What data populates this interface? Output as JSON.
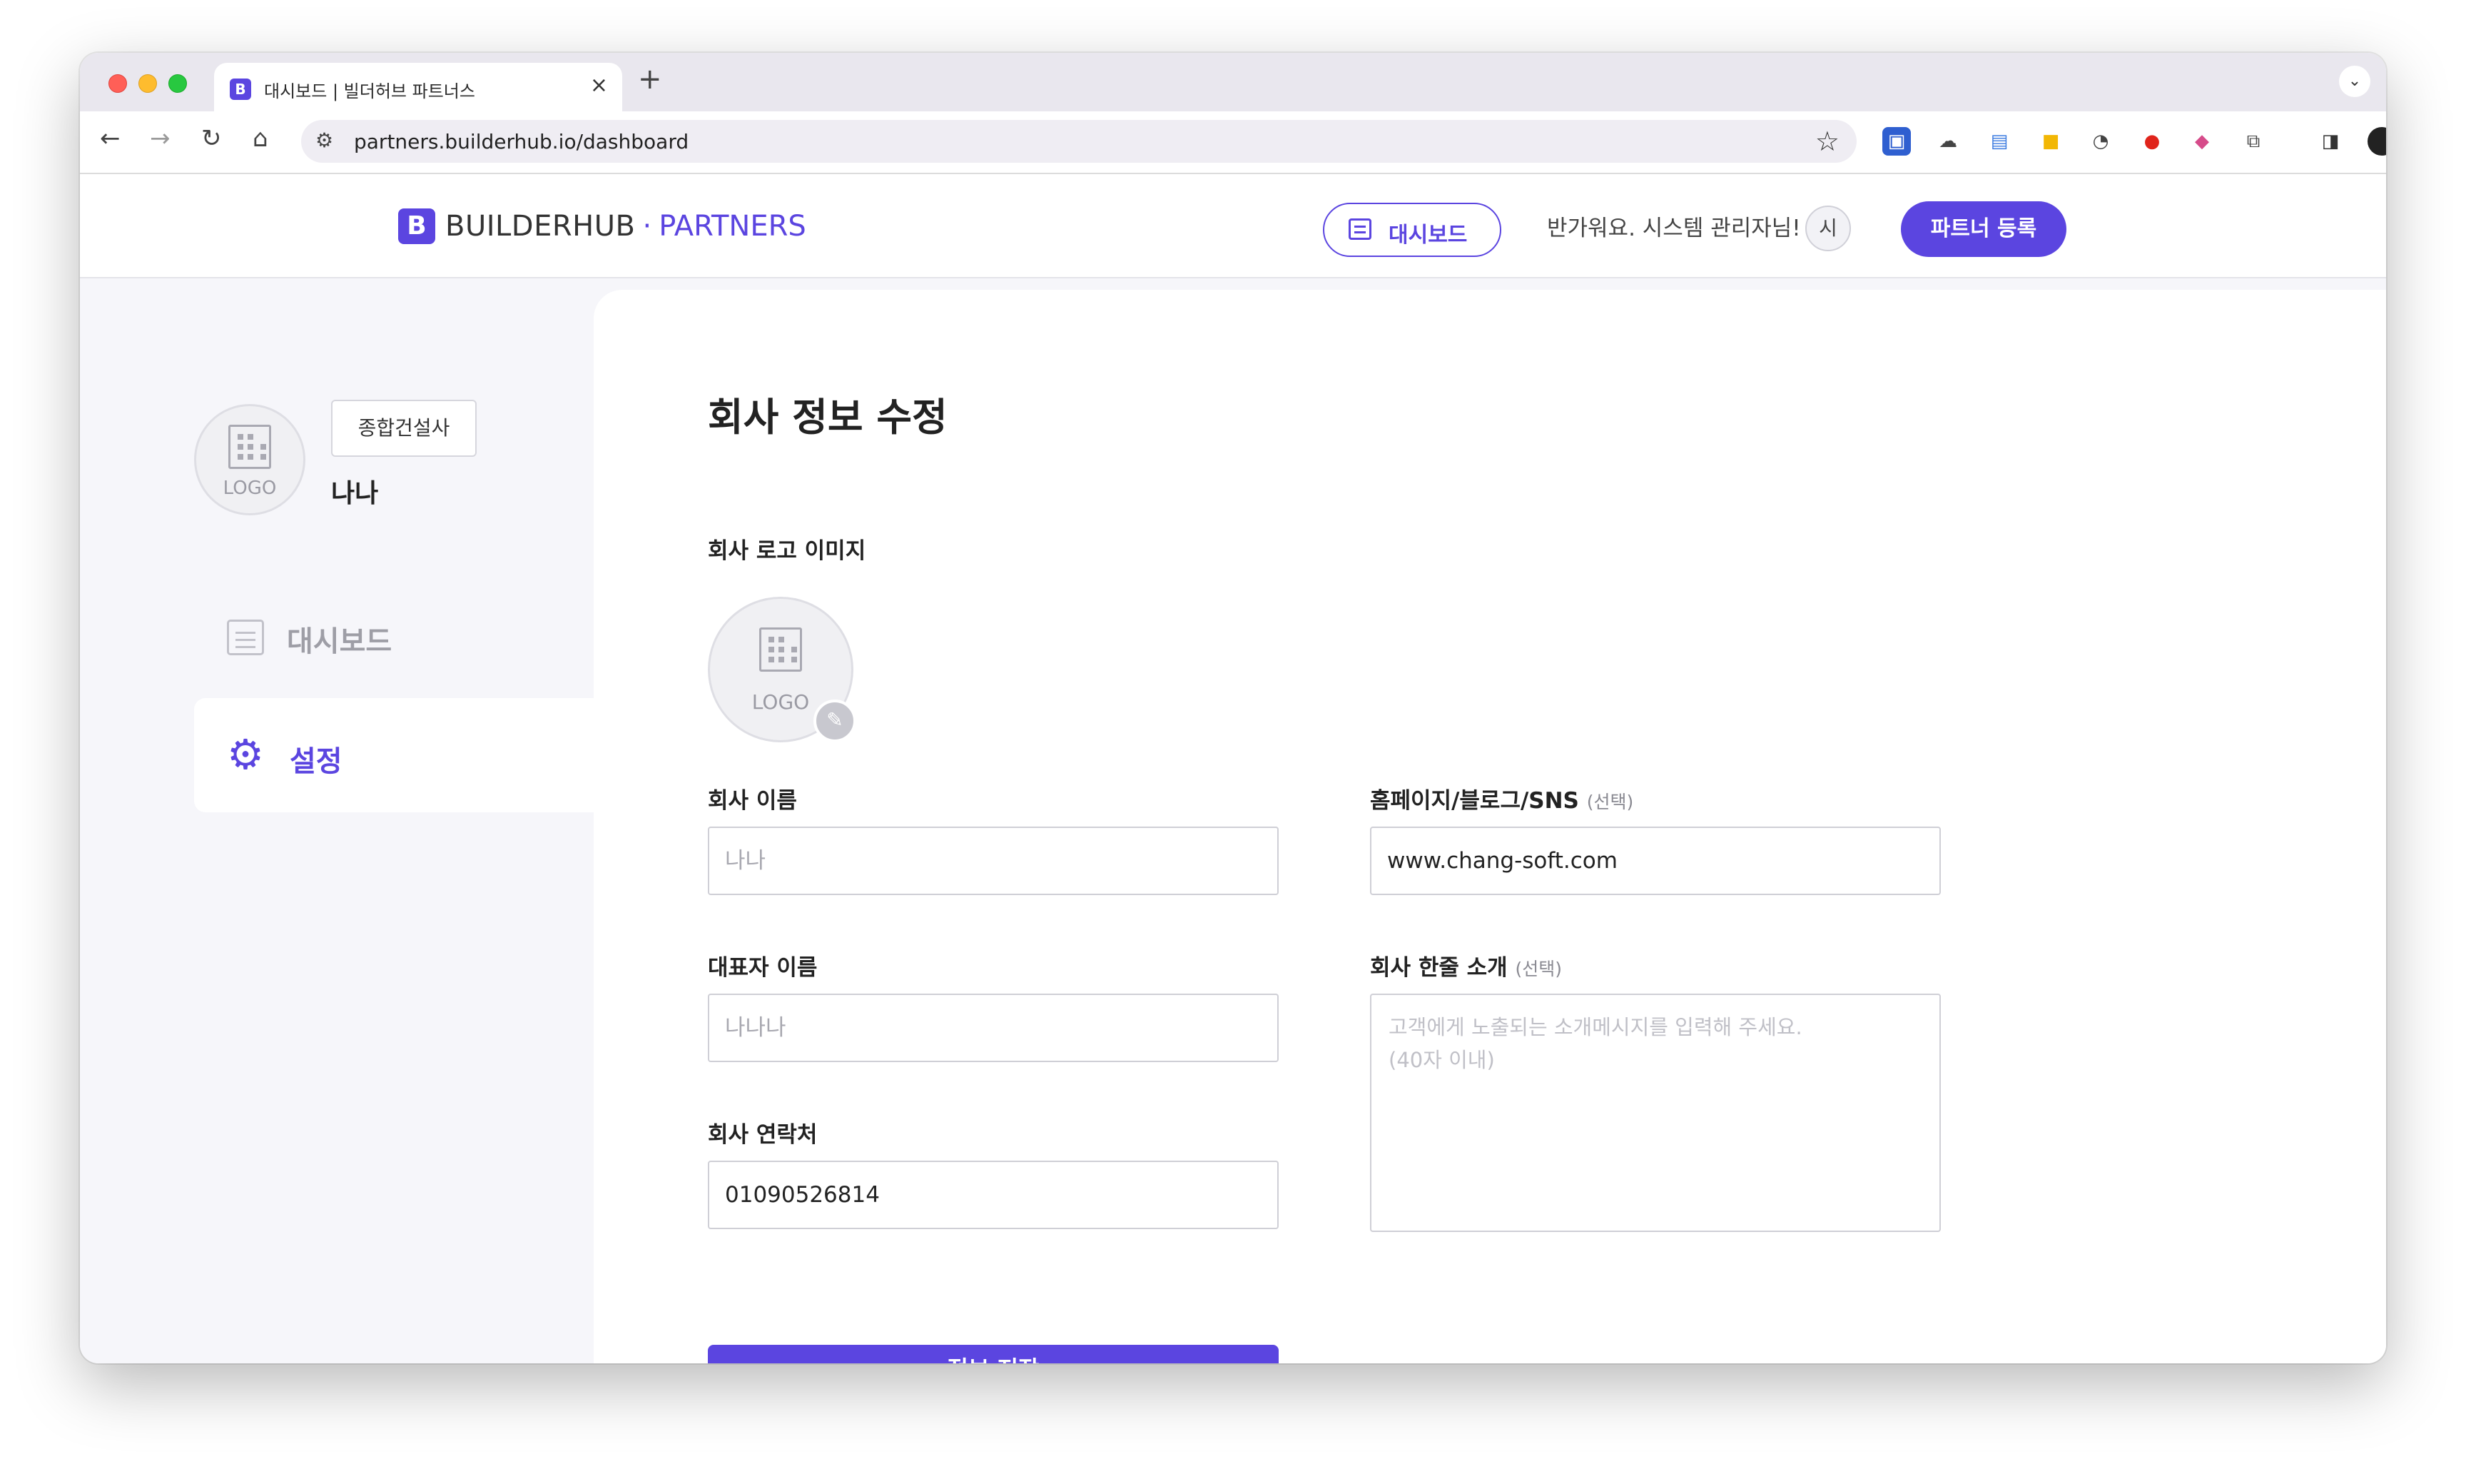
{
  "browser": {
    "tab_title": "대시보드 | 빌더허브 파트너스",
    "tab_favicon": "B",
    "url": "partners.builderhub.io/dashboard"
  },
  "header": {
    "brand_mark": "B",
    "brand_name": "BUILDERHUB",
    "brand_dot": "·",
    "brand_suffix": "PARTNERS",
    "dashboard_button": "대시보드",
    "welcome": "반가워요. 시스템 관리자님!",
    "avatar_initial": "시",
    "partner_register_button": "파트너 등록"
  },
  "sidebar": {
    "logo_text": "LOGO",
    "company_type": "종합건설사",
    "company_name": "나나",
    "menu": {
      "dashboard": "대시보드",
      "settings": "설정"
    }
  },
  "form": {
    "title": "회사 정보 수정",
    "logo_label": "회사 로고 이미지",
    "logo_text": "LOGO",
    "company_name_label": "회사 이름",
    "company_name_placeholder": "나나",
    "homepage_label": "홈페이지/블로그/SNS",
    "homepage_optional": "(선택)",
    "homepage_value": "www.chang-soft.com",
    "ceo_label": "대표자 이름",
    "ceo_placeholder": "나나나",
    "intro_label": "회사 한줄 소개",
    "intro_optional": "(선택)",
    "intro_placeholder": "고객에게 노출되는 소개메시지를 입력해 주세요.\n(40자 이내)",
    "contact_label": "회사 연락처",
    "contact_value": "01090526814",
    "save_button": "정보 저장"
  },
  "colors": {
    "accent": "#5b45e0",
    "page_background": "#f6f6fa"
  }
}
